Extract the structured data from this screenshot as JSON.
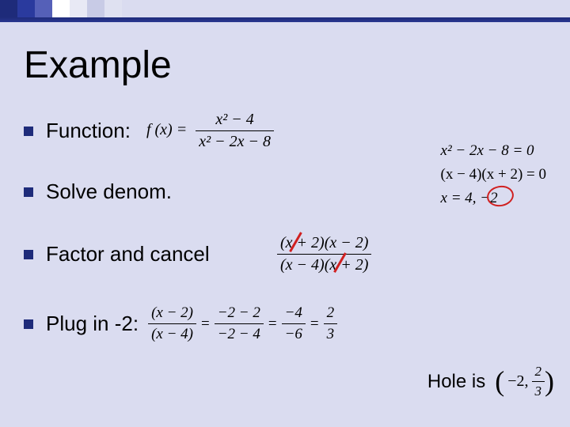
{
  "title": "Example",
  "bullets": {
    "b1": "Function:",
    "b2": "Solve denom.",
    "b3": "Factor and cancel",
    "b4": "Plug in -2:"
  },
  "func": {
    "lhs": "f (x) =",
    "num": "x² − 4",
    "den": "x² − 2x − 8"
  },
  "side": {
    "l1": "x² − 2x − 8 = 0",
    "l2": "(x − 4)(x + 2) = 0",
    "l3": "x = 4, −2"
  },
  "factor": {
    "num": "(x + 2)(x − 2)",
    "den": "(x − 4)(x + 2)"
  },
  "plug": {
    "f1n": "(x − 2)",
    "f1d": "(x − 4)",
    "f2n": "−2 − 2",
    "f2d": "−2 − 4",
    "f3n": "−4",
    "f3d": "−6",
    "f4n": "2",
    "f4d": "3"
  },
  "hole": {
    "label": "Hole is",
    "x": "−2,",
    "yn": "2",
    "yd": "3"
  }
}
